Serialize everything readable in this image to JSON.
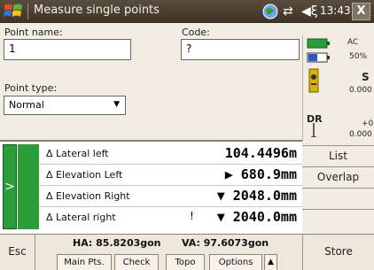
{
  "title_bar": {
    "title": "Measure single points",
    "clock": "13:43",
    "close_label": "X"
  },
  "form": {
    "point_name_label": "Point name:",
    "point_name_value": "1",
    "code_label": "Code:",
    "code_value": "?",
    "point_type_label": "Point type:",
    "point_type_value": "Normal"
  },
  "status_panel": {
    "power_label": "AC",
    "battery_label": "50%",
    "s_label": "S",
    "s_value": "0.000",
    "dr_label": "DR",
    "dr_offset": "+0",
    "dr_value": "0.000"
  },
  "measurements": [
    {
      "label": "Δ Lateral left",
      "value": "104.4496m",
      "indicator": ""
    },
    {
      "label": "Δ Elevation Left",
      "value": "▶ 680.9mm",
      "indicator": ""
    },
    {
      "label": "Δ Elevation Right",
      "value": "▼ 2048.0mm",
      "indicator": ""
    },
    {
      "label": "Δ Lateral right",
      "value": "▼ 2040.0mm",
      "indicator": "!"
    }
  ],
  "side_buttons": [
    "List",
    "Overlap",
    "",
    ""
  ],
  "footer": {
    "esc_label": "Esc",
    "ha": "HA: 85.8203gon",
    "va": "VA: 97.6073gon",
    "tabs": [
      "Main Pts.",
      "Check",
      "Topo",
      "Options"
    ],
    "store_label": "Store"
  },
  "colors": {
    "accent_green": "#2c9b3a",
    "titlebar": "#4a3f32"
  }
}
